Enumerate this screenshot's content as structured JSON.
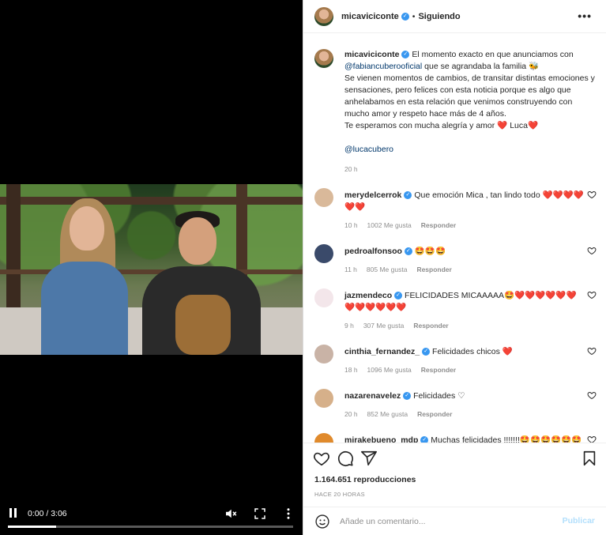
{
  "video": {
    "time": "0:00 / 3:06",
    "progress": 0.17
  },
  "header": {
    "username": "micaviciconte",
    "separator": "•",
    "follow_status": "Siguiendo",
    "more": "•••"
  },
  "caption": {
    "username": "micaviciconte",
    "text_1": "El momento exacto en que anunciamos con",
    "mention_1": "@fabiancuberooficial",
    "text_2": "que se agrandaba la familia 🐝",
    "text_3": "Se vienen momentos de cambios, de transitar distintas emociones y sensaciones, pero felices con esta noticia porque es algo que anhelabamos en esta relación que venimos construyendo con mucho amor y respeto hace más de 4 años.",
    "text_4": "Te esperamos con mucha alegría y amor",
    "heart": "❤️",
    "text_5": "Luca",
    "mention_2": "@lucacubero",
    "time": "20 h"
  },
  "comments": [
    {
      "user": "merydelcerrok",
      "text": "Que emoción Mica , tan lindo todo ❤️❤️❤️❤️❤️❤️",
      "time": "10 h",
      "likes": "1002 Me gusta",
      "reply": "Responder",
      "avatar_color": "#d9b99a"
    },
    {
      "user": "pedroalfonsoo",
      "text": "🤩🤩🤩",
      "time": "11 h",
      "likes": "805 Me gusta",
      "reply": "Responder",
      "avatar_color": "#3a4a6a"
    },
    {
      "user": "jazmendeco",
      "text": "FELICIDADES MICAAAAA🤩❤️❤️❤️❤️❤️❤️❤️❤️❤️❤️❤️❤️",
      "time": "9 h",
      "likes": "307 Me gusta",
      "reply": "Responder",
      "avatar_color": "#f3e6ea"
    },
    {
      "user": "cinthia_fernandez_",
      "text": "Felicidades chicos ❤️",
      "time": "18 h",
      "likes": "1096 Me gusta",
      "reply": "Responder",
      "avatar_color": "#c9b3a6"
    },
    {
      "user": "nazarenavelez",
      "text": "Felicidades ♡",
      "time": "20 h",
      "likes": "852 Me gusta",
      "reply": "Responder",
      "avatar_color": "#d6b08a"
    },
    {
      "user": "mirakebueno_mdp",
      "text": "Muchas felicidades !!!!!!!🤩🤩🤩🤩🤩🤩",
      "time": "",
      "likes": "",
      "reply": "",
      "avatar_color": "#e08a2c"
    }
  ],
  "actions": {
    "views": "1.164.651 reproducciones",
    "ago": "HACE 20 HORAS"
  },
  "composer": {
    "placeholder": "Añade un comentario...",
    "publish": "Publicar"
  },
  "colors": {
    "verified": "#3897f0",
    "mention": "#00376b",
    "publish_disabled": "#b2dffc",
    "heart": "#e0245e"
  },
  "icons": [
    "play-pause-icon",
    "mute-icon",
    "fullscreen-icon",
    "more-vertical-icon",
    "verified-icon",
    "heart-icon",
    "comment-icon",
    "share-icon",
    "bookmark-icon",
    "emoji-icon"
  ]
}
